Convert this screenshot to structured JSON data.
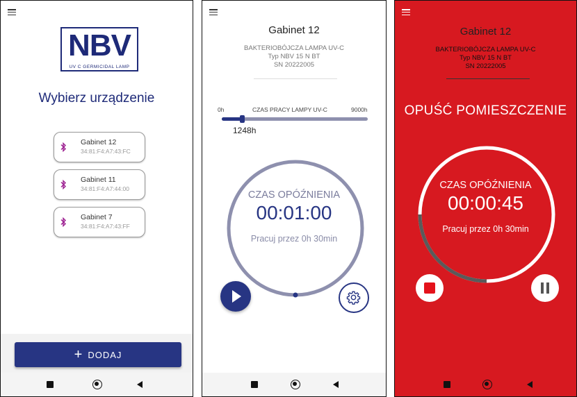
{
  "screen1": {
    "logo": {
      "main": "NBV",
      "sub": "UV C GERMICIDAL LAMP"
    },
    "title": "Wybierz urządzenie",
    "devices": [
      {
        "name": "Gabinet 12",
        "mac": "34:81:F4:A7:43:FC"
      },
      {
        "name": "Gabinet 11",
        "mac": "34:81:F4:A7:44:00"
      },
      {
        "name": "Gabinet 7",
        "mac": "34:81:F4:A7:43:FF"
      }
    ],
    "add_button": {
      "icon": "+",
      "label": "DODAJ"
    }
  },
  "screen2": {
    "room": "Gabinet 12",
    "lamp_line1": "BAKTERIOBÓJCZA LAMPA UV-C",
    "lamp_line2": "Typ NBV 15 N BT",
    "lamp_line3": "SN 20222005",
    "slider": {
      "min_label": "0h",
      "title": "CZAS PRACY LAMPY UV-C",
      "max_label": "9000h",
      "value_label": "1248h",
      "fraction": 0.139
    },
    "delay_label": "CZAS OPÓŹNIENIA",
    "delay_time": "00:01:00",
    "work_text": "Pracuj przez 0h 30min"
  },
  "screen3": {
    "room": "Gabinet 12",
    "lamp_line1": "BAKTERIOBÓJCZA LAMPA UV-C",
    "lamp_line2": "Typ NBV 15 N BT",
    "lamp_line3": "SN 20222005",
    "message": "OPUŚĆ POMIESZCZENIE",
    "delay_label": "CZAS OPÓŹNIENIA",
    "delay_time": "00:00:45",
    "work_text": "Pracuj przez 0h 30min",
    "countdown_fraction_elapsed": 0.25
  },
  "colors": {
    "brand": "#273583",
    "alarm": "#d71920",
    "bluetooth": "#9b1c8f",
    "ring_idle": "#8e90ae"
  },
  "icons": [
    "menu-icon",
    "bluetooth-icon",
    "plus-icon",
    "play-icon",
    "gear-icon",
    "stop-icon",
    "pause-icon",
    "nav-recents-icon",
    "nav-home-icon",
    "nav-back-icon"
  ]
}
